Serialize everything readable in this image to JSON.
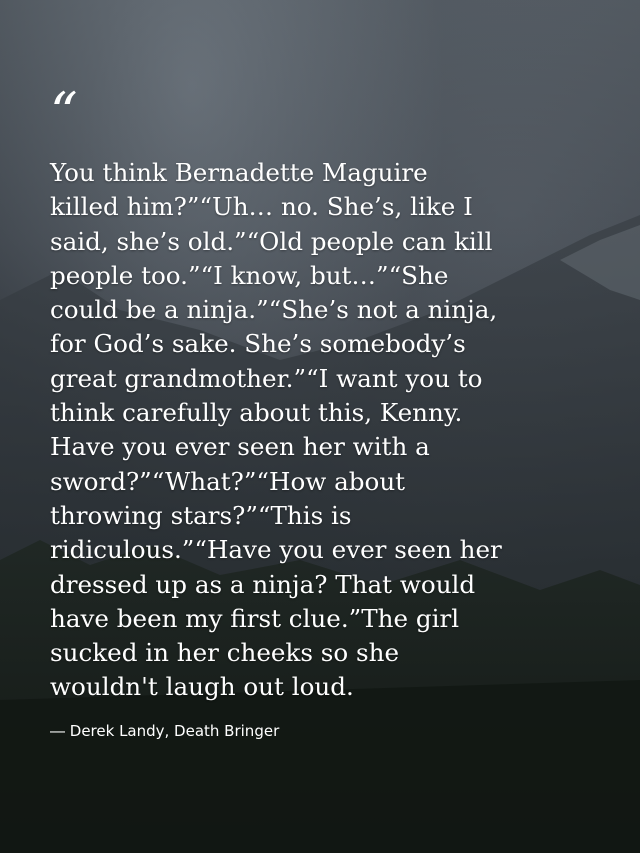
{
  "quote": {
    "mark": "“",
    "text": "You think Bernadette Maguire\nkilled him?”“Uh… no. She’s, like I\nsaid, she’s old.”“Old people can kill\npeople too.”“I know, but…”“She\ncould be a ninja.”“She’s not a ninja,\nfor God’s sake. She’s somebody’s\ngreat grandmother.”“I want you to\nthink carefully about this, Kenny.\nHave you ever seen her with a\nsword?”“What?”“How about\nthrowing stars?”“This is\nridiculous.”“Have you ever seen her\ndressed up as a ninja? That would\nhave been my first clue.”The girl\nsucked in her cheeks so she\nwouldn't laugh out loud.",
    "attribution": "― Derek Landy, Death Bringer"
  }
}
